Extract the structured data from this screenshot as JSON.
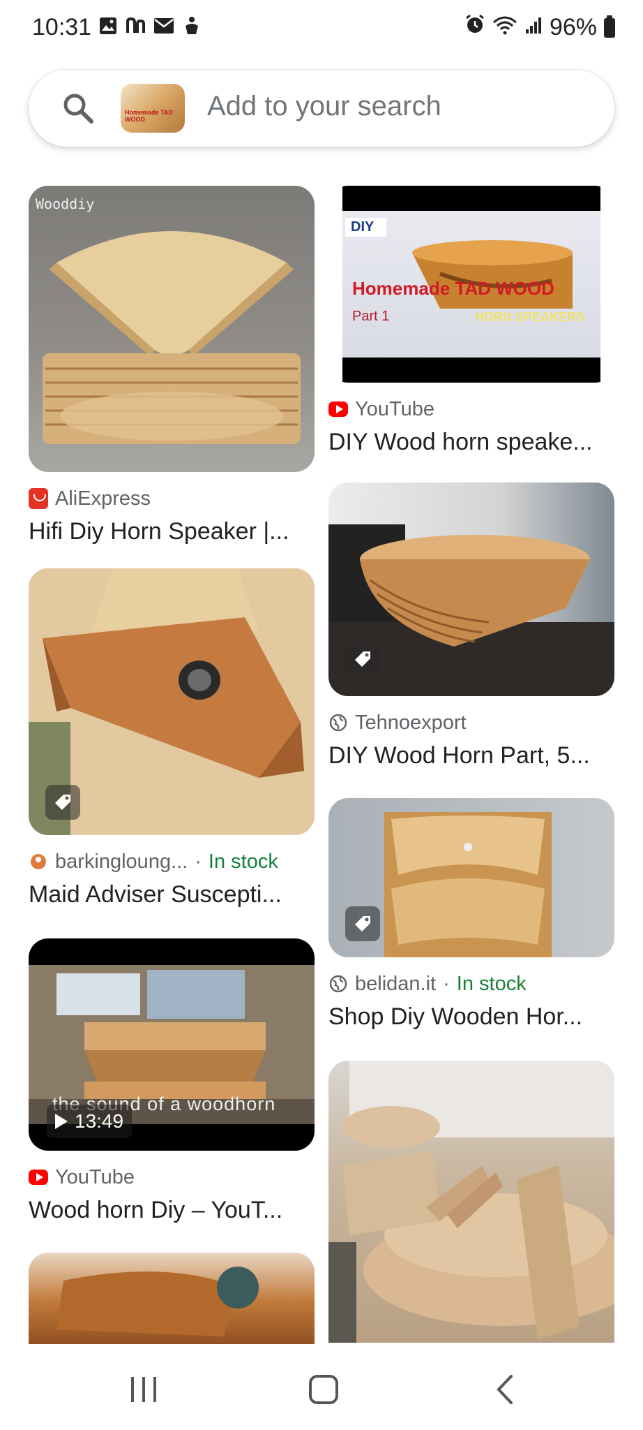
{
  "status_bar": {
    "time": "10:31",
    "battery_text": "96%",
    "left_icons": [
      "gallery-icon",
      "n-app-icon",
      "mail-icon",
      "accessibility-icon"
    ],
    "right_icons": [
      "alarm-icon",
      "wifi-icon",
      "signal-icon",
      "battery-icon"
    ]
  },
  "search": {
    "placeholder": "Add to your search",
    "thumb_text": "Homemade TAD WOOD"
  },
  "results_left": [
    {
      "source": "AliExpress",
      "source_icon": "aliexpress-icon",
      "title": "Hifi Diy Horn Speaker |...",
      "watermark": "Wooddiy"
    },
    {
      "source": "barkingloung...",
      "source_icon": "site-icon",
      "stock": "In stock",
      "title": "Maid Adviser Suscepti..."
    },
    {
      "source": "YouTube",
      "source_icon": "youtube-icon",
      "title": "Wood horn Diy – YouT...",
      "duration": "13:49",
      "overlay_caption": "the sound of a woodhorn"
    }
  ],
  "results_right": [
    {
      "source": "YouTube",
      "source_icon": "youtube-icon",
      "title": "DIY Wood horn speake...",
      "badge": "DIY",
      "overlay_line1": "Homemade TAD WOOD",
      "overlay_line2": "Part 1",
      "overlay_line3": "HORN SPEAKERS"
    },
    {
      "source": "Tehnoexport",
      "source_icon": "globe-icon",
      "title": "DIY Wood Horn Part, 5..."
    },
    {
      "source": "belidan.it",
      "source_icon": "globe-icon",
      "stock": "In stock",
      "title": "Shop Diy Wooden Hor..."
    }
  ],
  "nav": {
    "buttons": [
      "recent-apps-button",
      "home-button",
      "back-button"
    ]
  }
}
